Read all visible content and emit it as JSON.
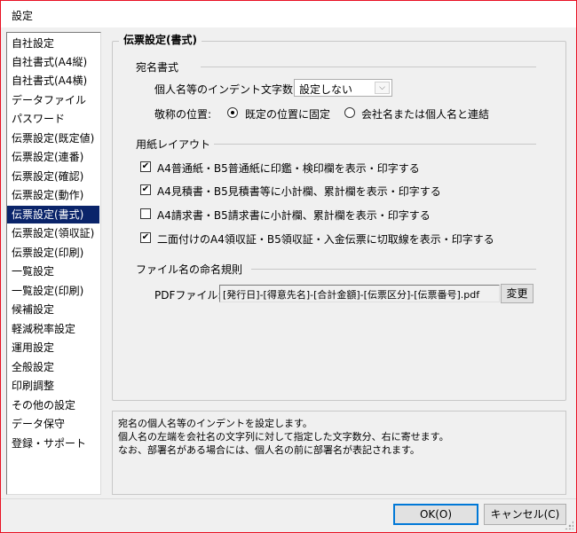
{
  "window": {
    "title": "設定"
  },
  "sidebar": {
    "items": [
      {
        "label": "自社設定"
      },
      {
        "label": "自社書式(A4縦)"
      },
      {
        "label": "自社書式(A4横)"
      },
      {
        "label": "データファイル"
      },
      {
        "label": "パスワード"
      },
      {
        "label": "伝票設定(既定値)"
      },
      {
        "label": "伝票設定(連番)"
      },
      {
        "label": "伝票設定(確認)"
      },
      {
        "label": "伝票設定(動作)"
      },
      {
        "label": "伝票設定(書式)",
        "selected": true
      },
      {
        "label": "伝票設定(領収証)"
      },
      {
        "label": "伝票設定(印刷)"
      },
      {
        "label": "一覧設定"
      },
      {
        "label": "一覧設定(印刷)"
      },
      {
        "label": "候補設定"
      },
      {
        "label": "軽減税率設定"
      },
      {
        "label": "運用設定"
      },
      {
        "label": "全般設定"
      },
      {
        "label": "印刷調整"
      },
      {
        "label": "その他の設定"
      },
      {
        "label": "データ保守"
      },
      {
        "label": "登録・サポート"
      }
    ]
  },
  "panel": {
    "title": "伝票設定(書式)",
    "address": {
      "section": "宛名書式",
      "indent_label": "個人名等のインデント文字数:",
      "indent_value": "設定しない",
      "honorific_label": "敬称の位置:",
      "honorific_options": [
        {
          "label": "既定の位置に固定",
          "checked": true
        },
        {
          "label": "会社名または個人名と連結",
          "checked": false
        }
      ]
    },
    "paper": {
      "section": "用紙レイアウト",
      "options": [
        {
          "label": "A4普通紙・B5普通紙に印鑑・検印欄を表示・印字する",
          "checked": true
        },
        {
          "label": "A4見積書・B5見積書等に小計欄、累計欄を表示・印字する",
          "checked": true
        },
        {
          "label": "A4請求書・B5請求書に小計欄、累計欄を表示・印字する",
          "checked": false
        },
        {
          "label": "二面付けのA4領収証・B5領収証・入金伝票に切取線を表示・印字する",
          "checked": true
        }
      ]
    },
    "filename": {
      "section": "ファイル名の命名規則",
      "pdf_label": "PDFファイル:",
      "pdf_value": "[発行日]-[得意先名]-[合計金額]-[伝票区分]-[伝票番号].pdf",
      "change_button": "変更"
    }
  },
  "description": {
    "lines": [
      "宛名の個人名等のインデントを設定します。",
      "個人名の左端を会社名の文字列に対して指定した文字数分、右に寄せます。",
      "なお、部署名がある場合には、個人名の前に部署名が表記されます。"
    ]
  },
  "buttons": {
    "ok": "OK(O)",
    "cancel": "キャンセル(C)"
  }
}
